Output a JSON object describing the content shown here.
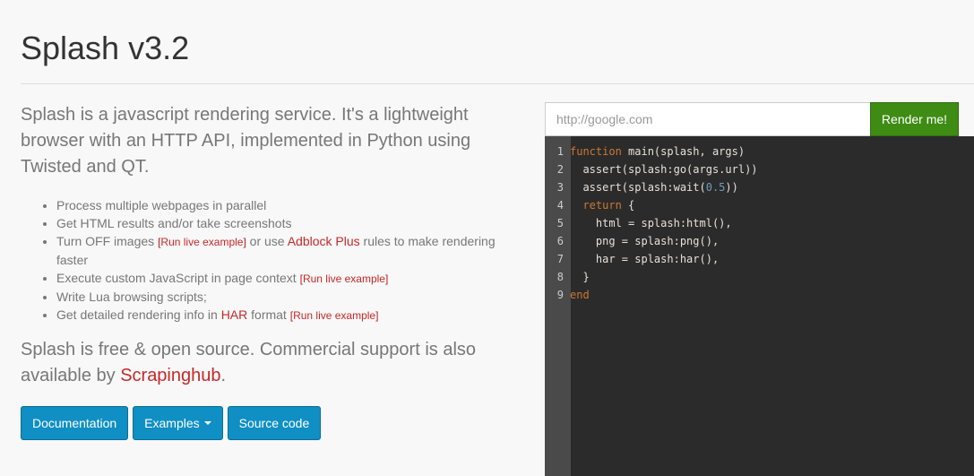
{
  "header": {
    "title": "Splash v3.2"
  },
  "intro": "Splash is a javascript rendering service. It's a lightweight browser with an HTTP API, implemented in Python using Twisted and QT.",
  "features": {
    "f1": "Process multiple webpages in parallel",
    "f2": "Get HTML results and/or take screenshots",
    "f3_a": "Turn OFF images ",
    "f3_b": " or use ",
    "f3_link": "Adblock Plus",
    "f3_c": " rules to make rendering faster",
    "f4": "Execute custom JavaScript in page context ",
    "f5": "Write Lua browsing scripts;",
    "f6_a": "Get detailed rendering info in ",
    "f6_link": "HAR",
    "f6_b": " format ",
    "live_example": "Run live example",
    "bracket_open": "[",
    "bracket_close": "]"
  },
  "support": {
    "text": "Splash is free & open source. Commercial support is also available by ",
    "link": "Scrapinghub",
    "end": "."
  },
  "buttons": {
    "documentation": "Documentation",
    "examples": "Examples",
    "source": "Source code"
  },
  "render": {
    "url_placeholder": "http://google.com",
    "button": "Render me!"
  },
  "code_lines": {
    "l1": {
      "n": "1",
      "kw": "function",
      "rest": " main(splash, args)"
    },
    "l2": {
      "n": "2",
      "text": "  assert(splash:go(args.url))"
    },
    "l3": {
      "n": "3",
      "pre": "  assert(splash:wait(",
      "num": "0.5",
      "post": "))"
    },
    "l4": {
      "n": "4",
      "pre": "  ",
      "kw": "return",
      "rest": " {"
    },
    "l5": {
      "n": "5",
      "text": "    html = splash:html(),"
    },
    "l6": {
      "n": "6",
      "text": "    png = splash:png(),"
    },
    "l7": {
      "n": "7",
      "text": "    har = splash:har(),"
    },
    "l8": {
      "n": "8",
      "text": "  }"
    },
    "l9": {
      "n": "9",
      "kw": "end"
    }
  },
  "colors": {
    "button_blue": "#0f8fc3",
    "render_green": "#3e8c14",
    "link_red": "#c62828",
    "editor_bg": "#2b2b2b",
    "keyword": "#cc7833",
    "number": "#6d9cbe"
  }
}
